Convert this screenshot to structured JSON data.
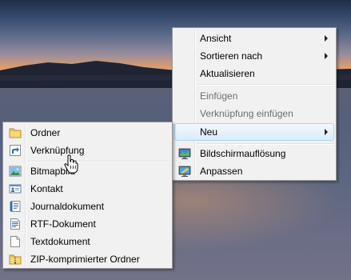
{
  "desktop_menu": {
    "items": [
      {
        "label": "Ansicht"
      },
      {
        "label": "Sortieren nach"
      },
      {
        "label": "Aktualisieren"
      },
      {
        "label": "Einfügen"
      },
      {
        "label": "Verknüpfung einfügen"
      },
      {
        "label": "Neu"
      },
      {
        "label": "Bildschirmauflösung"
      },
      {
        "label": "Anpassen"
      }
    ]
  },
  "new_submenu": {
    "items": [
      {
        "label": "Ordner",
        "icon": "folder-icon"
      },
      {
        "label": "Verknüpfung",
        "icon": "shortcut-icon"
      },
      {
        "label": "Bitmapbild",
        "icon": "bitmap-image-icon"
      },
      {
        "label": "Kontakt",
        "icon": "contact-card-icon"
      },
      {
        "label": "Journaldokument",
        "icon": "journal-document-icon"
      },
      {
        "label": "RTF-Dokument",
        "icon": "rtf-document-icon"
      },
      {
        "label": "Textdokument",
        "icon": "text-document-icon"
      },
      {
        "label": "ZIP-komprimierter Ordner",
        "icon": "zip-folder-icon"
      }
    ]
  },
  "colors": {
    "menu_background": "#f1f1f1",
    "hover_border": "#a8d8f7",
    "disabled_text": "#6d6d6d"
  }
}
